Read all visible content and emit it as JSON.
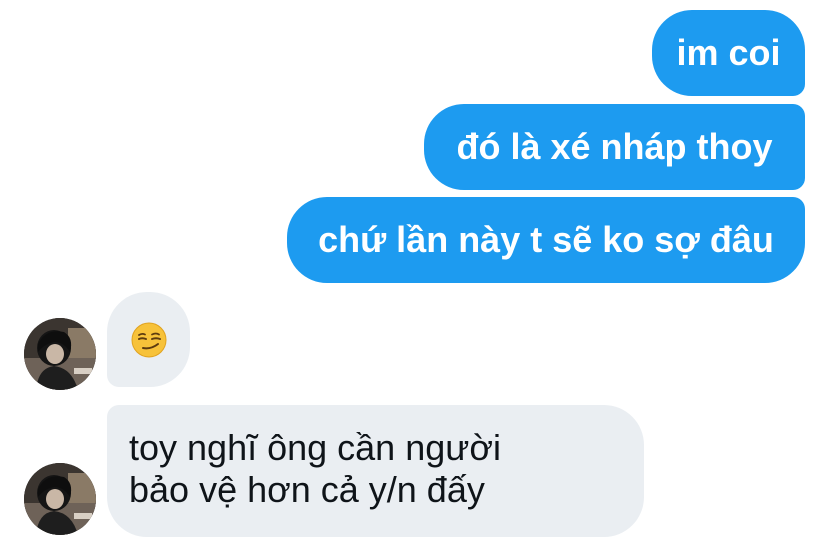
{
  "conversation": {
    "outgoing": [
      {
        "text": "im coi"
      },
      {
        "text": "đó là xé nháp thoy"
      },
      {
        "text": "chứ lần này t sẽ ko sợ đâu"
      }
    ],
    "incoming": [
      {
        "emoji": "smirking-face"
      },
      {
        "lines": [
          "toy nghĩ ông cần người",
          "bảo vệ hơn cả y/n đấy"
        ]
      }
    ]
  },
  "colors": {
    "sent_bubble": "#1d9bf0",
    "received_bubble": "#eaeef2",
    "sent_text": "#ffffff",
    "received_text": "#0f1419"
  },
  "icons": {
    "avatar": "contact-avatar-photo",
    "emoji": "smirking-face-emoji"
  }
}
